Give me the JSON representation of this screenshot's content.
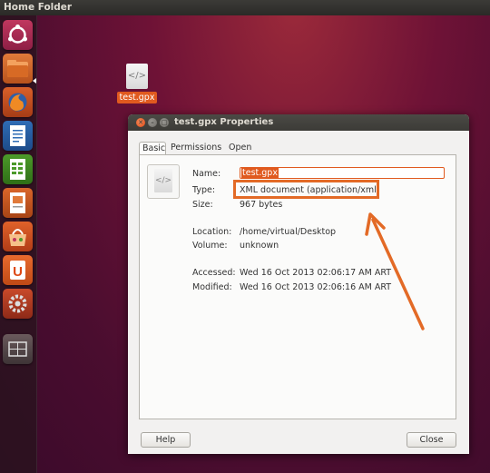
{
  "topbar": {
    "title": "Home Folder"
  },
  "launcher": {
    "items": [
      "dash-home-icon",
      "files-icon",
      "firefox-icon",
      "writer-icon",
      "calc-icon",
      "impress-icon",
      "software-center-icon",
      "ubuntu-one-icon",
      "system-settings-icon",
      "workspace-switcher-icon"
    ]
  },
  "desktop": {
    "file_label": "test.gpx",
    "file_glyph": "</>"
  },
  "dialog": {
    "title": "test.gpx Properties",
    "tabs": {
      "basic": "Basic",
      "permissions": "Permissions",
      "open_with": "Open With"
    },
    "fields": {
      "name_label": "Name:",
      "name_value": "test.gpx",
      "type_label": "Type:",
      "type_value": "XML document (application/xml)",
      "size_label": "Size:",
      "size_value": "967 bytes",
      "location_label": "Location:",
      "location_value": "/home/virtual/Desktop",
      "volume_label": "Volume:",
      "volume_value": "unknown",
      "accessed_label": "Accessed:",
      "accessed_value": "Wed 16 Oct 2013 02:06:17 AM ART",
      "modified_label": "Modified:",
      "modified_value": "Wed 16 Oct 2013 02:06:16 AM ART"
    },
    "buttons": {
      "help": "Help",
      "close": "Close"
    }
  },
  "colors": {
    "accent": "#e05a1f",
    "annotation": "#e36a26"
  }
}
